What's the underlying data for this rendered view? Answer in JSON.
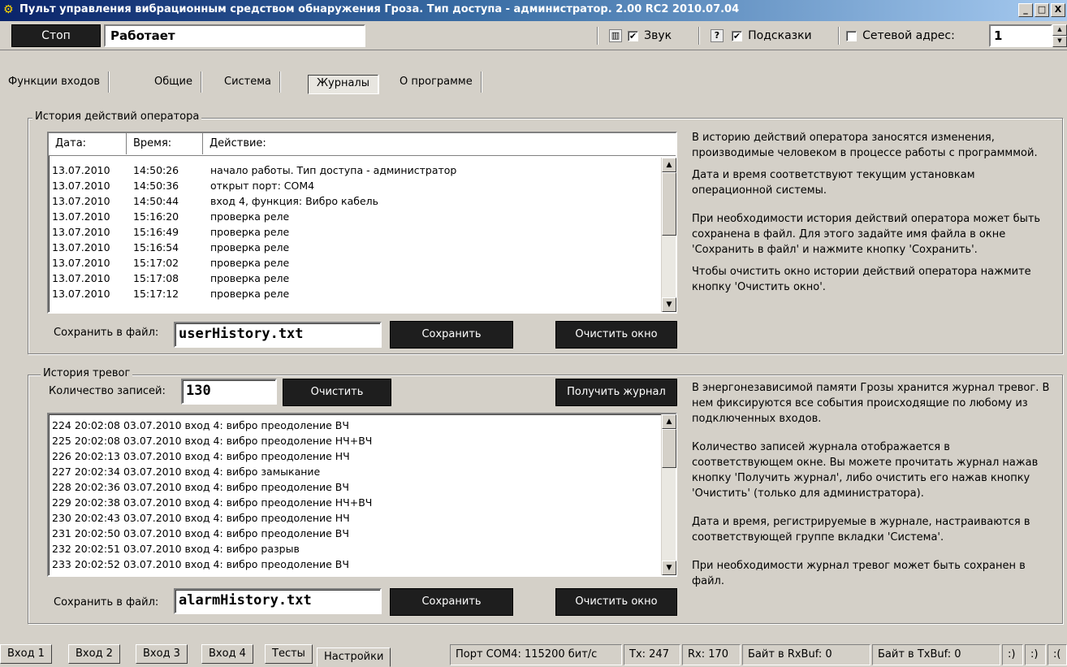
{
  "window": {
    "title": "Пульт управления вибрационным средством обнаружения Гроза. Тип доступа - администратор. 2.00 RC2 2010.07.04",
    "min_label": "_",
    "max_label": "□",
    "close_label": "X"
  },
  "toolbar": {
    "stop_label": "Стоп",
    "status_value": "Работает",
    "sound_label": "Звук",
    "sound_checked": "✔",
    "hints_label": "Подсказки",
    "hints_checked": "✔",
    "network_label": "Сетевой адрес:",
    "network_checked": "",
    "network_value": "1",
    "help_icon_label": "?"
  },
  "tabs": [
    {
      "label": "Функции входов"
    },
    {
      "label": "Общие"
    },
    {
      "label": "Система"
    },
    {
      "label": "Журналы"
    },
    {
      "label": "О программе"
    }
  ],
  "operator_history": {
    "title": "История действий оператора",
    "columns": [
      "Дата:",
      "Время:",
      "Действие:"
    ],
    "rows": [
      {
        "date": "13.07.2010",
        "time": "14:50:26",
        "action": "начало работы. Тип доступа - администратор"
      },
      {
        "date": "13.07.2010",
        "time": "14:50:36",
        "action": "открыт порт: COM4"
      },
      {
        "date": "13.07.2010",
        "time": "14:50:44",
        "action": "вход 4, функция: Вибро кабель"
      },
      {
        "date": "13.07.2010",
        "time": "15:16:20",
        "action": "проверка реле"
      },
      {
        "date": "13.07.2010",
        "time": "15:16:49",
        "action": "проверка реле"
      },
      {
        "date": "13.07.2010",
        "time": "15:16:54",
        "action": "проверка реле"
      },
      {
        "date": "13.07.2010",
        "time": "15:17:02",
        "action": "проверка реле"
      },
      {
        "date": "13.07.2010",
        "time": "15:17:08",
        "action": "проверка реле"
      },
      {
        "date": "13.07.2010",
        "time": "15:17:12",
        "action": "проверка реле"
      }
    ],
    "save_to_file_label": "Сохранить в файл:",
    "file_value": "userHistory.txt",
    "save_button": "Сохранить",
    "clear_button": "Очистить окно",
    "help": [
      "В историю действий оператора заносятся изменения, производимые человеком в процессе работы с программмой.",
      "Дата и время соответствуют текущим установкам операционной системы.",
      "При необходимости история действий оператора может быть сохранена в файл. Для этого задайте имя файла в окне 'Сохранить в файл' и нажмите кнопку 'Сохранить'.",
      "Чтобы очистить окно истории действий оператора нажмите кнопку 'Очистить окно'."
    ]
  },
  "alarm_history": {
    "title": "История тревог",
    "count_label": "Количество записей:",
    "count_value": "130",
    "clear_button": "Очистить",
    "get_log_button": "Получить журнал",
    "rows": [
      "224 20:02:08 03.07.2010 вход 4: вибро преодоление ВЧ",
      "225 20:02:08 03.07.2010 вход 4: вибро преодоление НЧ+ВЧ",
      "226 20:02:13 03.07.2010 вход 4: вибро преодоление НЧ",
      "227 20:02:34 03.07.2010 вход 4: вибро замыкание",
      "228 20:02:36 03.07.2010 вход 4: вибро преодоление ВЧ",
      "229 20:02:38 03.07.2010 вход 4: вибро преодоление НЧ+ВЧ",
      "230 20:02:43 03.07.2010 вход 4: вибро преодоление НЧ",
      "231 20:02:50 03.07.2010 вход 4: вибро преодоление ВЧ",
      "232 20:02:51 03.07.2010 вход 4: вибро разрыв",
      "233 20:02:52 03.07.2010 вход 4: вибро преодоление ВЧ"
    ],
    "save_to_file_label": "Сохранить в файл:",
    "file_value": "alarmHistory.txt",
    "save_button": "Сохранить",
    "clear_window_button": "Очистить окно",
    "help": [
      "В энергонезависимой памяти Грозы хранится журнал тревог. В нем фиксируются все события происходящие по любому из подключенных входов.",
      "Количество записей журнала отображается в соответствующем окне. Вы можете прочитать журнал нажав кнопку 'Получить журнал', либо очистить его нажав кнопку 'Очистить' (только для администратора).",
      "Дата и время, регистрируемые в журнале, настраиваются в соответствующей группе вкладки 'Система'.",
      "При необходимости журнал тревог может быть сохранен в файл."
    ]
  },
  "bottom_tabs": [
    {
      "label": "Вход 1"
    },
    {
      "label": "Вход 2"
    },
    {
      "label": "Вход 3"
    },
    {
      "label": "Вход 4"
    },
    {
      "label": "Тесты"
    },
    {
      "label": "Настройки"
    }
  ],
  "statusbar": {
    "port": "Порт COM4: 115200 бит/с",
    "tx": "Tx: 247",
    "rx": "Rx: 170",
    "rxbuf": "Байт в RxBuf: 0",
    "txbuf": "Байт в TxBuf: 0",
    "smile1": ":)",
    "smile2": ":)",
    "smile3": ":("
  },
  "colors": {
    "title_gradient_start": "#0a246a",
    "title_gradient_end": "#a6caf0",
    "face": "#d4d0c8",
    "dark_button": "#1e1e1e"
  }
}
